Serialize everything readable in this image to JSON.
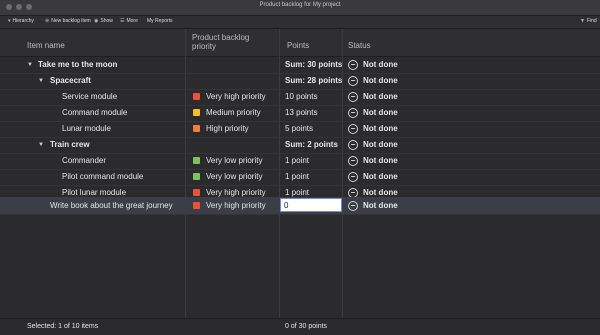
{
  "window": {
    "title": "Product backlog for My project"
  },
  "toolbar": {
    "items": [
      {
        "label": "Hierarchy"
      },
      {
        "label": "New backlog item"
      },
      {
        "label": "Show"
      },
      {
        "label": "More"
      },
      {
        "label": "My Reports"
      }
    ],
    "find_label": "Find"
  },
  "columns": {
    "item_name": "Item name",
    "priority": "Product backlog priority",
    "points": "Points",
    "status": "Status"
  },
  "rows": [
    {
      "name": "Take me to the moon",
      "priority": "",
      "priority_color": "",
      "points": "Sum: 30 points",
      "status": "Not done",
      "bold": true
    },
    {
      "name": "Spacecraft",
      "priority": "",
      "priority_color": "",
      "points": "Sum: 28 points",
      "status": "Not done",
      "bold": true
    },
    {
      "name": "Service module",
      "priority": "Very high priority",
      "priority_color": "#e8513a",
      "points": "10 points",
      "status": "Not done",
      "bold": false
    },
    {
      "name": "Command module",
      "priority": "Medium priority",
      "priority_color": "#f2c12e",
      "points": "13 points",
      "status": "Not done",
      "bold": false
    },
    {
      "name": "Lunar module",
      "priority": "High priority",
      "priority_color": "#f07d3b",
      "points": "5 points",
      "status": "Not done",
      "bold": false
    },
    {
      "name": "Train crew",
      "priority": "",
      "priority_color": "",
      "points": "Sum: 2 points",
      "status": "Not done",
      "bold": true
    },
    {
      "name": "Commander",
      "priority": "Very low priority",
      "priority_color": "#7cc35b",
      "points": "1 point",
      "status": "Not done",
      "bold": false
    },
    {
      "name": "Pilot command module",
      "priority": "Very low priority",
      "priority_color": "#7cc35b",
      "points": "1 point",
      "status": "Not done",
      "bold": false
    },
    {
      "name": "Pilot lunar module",
      "priority": "Very high priority",
      "priority_color": "#e8513a",
      "points": "1 point",
      "status": "Not done",
      "bold": false
    },
    {
      "name": "Write book about the great journey",
      "priority": "Very high priority",
      "priority_color": "#e8513a",
      "points": "",
      "status": "Not done",
      "bold": false
    }
  ],
  "edit_value": "0",
  "footer": {
    "selected": "Selected: 1 of 10 items",
    "points_total": "0 of 30 points"
  }
}
